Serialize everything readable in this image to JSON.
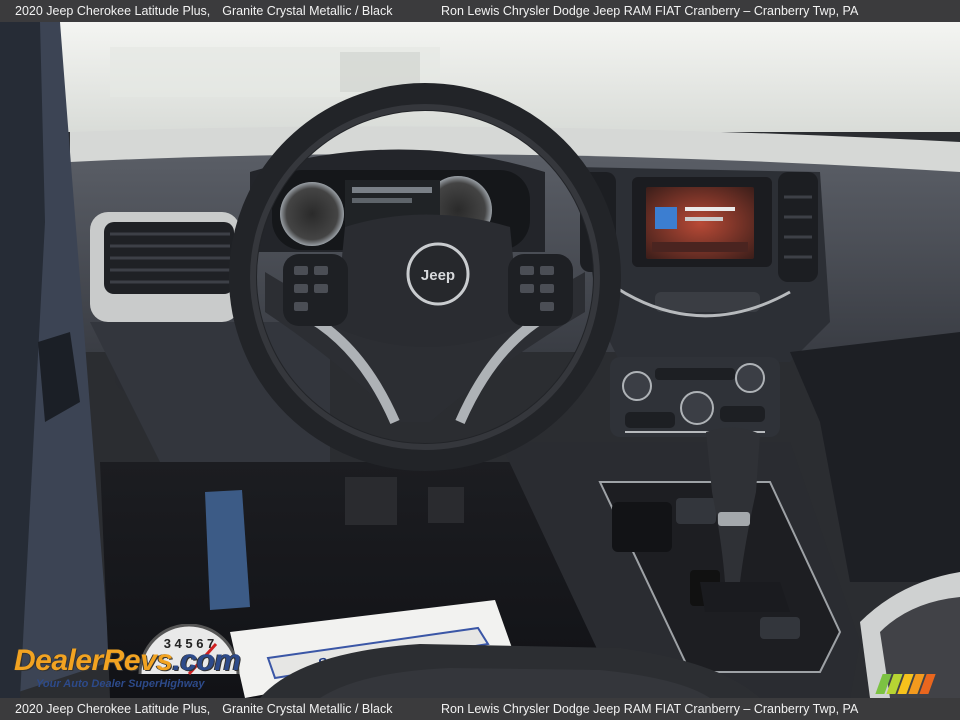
{
  "header": {
    "vehicle": "2020 Jeep Cherokee Latitude Plus,",
    "color": "Granite Crystal Metallic / Black",
    "dealer": "Ron Lewis Chrysler Dodge Jeep RAM FIAT Cranberry – Cranberry Twp, PA"
  },
  "footer": {
    "vehicle": "2020 Jeep Cherokee Latitude Plus,",
    "color": "Granite Crystal Metallic / Black",
    "dealer": "Ron Lewis Chrysler Dodge Jeep RAM FIAT Cranberry – Cranberry Twp, PA"
  },
  "photo": {
    "steering_badge": "Jeep",
    "paper_text": "Service & Parts"
  },
  "watermark": {
    "brand": "DealerRevs",
    "brand_suffix": ".com",
    "tagline": "Your Auto Dealer SuperHighway",
    "gauge_digits": "3 4 5 6 7"
  },
  "colors": {
    "bar_bg": "#3b3b3d",
    "logo_orange": "#f2a321",
    "logo_blue": "#2d4a8a",
    "stripes": [
      "#7cc242",
      "#b7d433",
      "#f6c21c",
      "#f39a1e",
      "#e9661e"
    ]
  }
}
